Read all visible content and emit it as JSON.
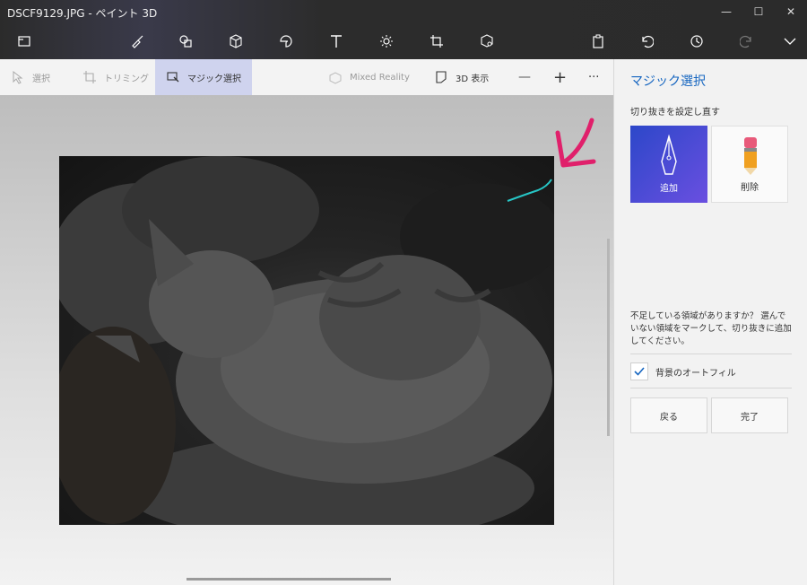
{
  "window": {
    "title": "DSCF9129.JPG - ペイント 3D",
    "buttons": [
      "—",
      "☐",
      "✕"
    ]
  },
  "toolbar": {
    "icons": [
      "menu-icon",
      "brush-icon",
      "2d-shapes-icon",
      "3d-shapes-icon",
      "stickers-icon",
      "text-icon",
      "effects-icon",
      "canvas-icon",
      "3d-library-icon",
      "paste-icon",
      "undo-icon",
      "history-icon",
      "redo-icon",
      "expand-icon"
    ]
  },
  "subbar": {
    "select": "選択",
    "crop": "トリミング",
    "magic_select": "マジック選択",
    "mixed_reality": "Mixed Reality",
    "view3d": "3D 表示",
    "zoom_out": "—",
    "zoom_in": "+",
    "more": "···"
  },
  "panel": {
    "title": "マジック選択",
    "subtitle": "切り抜きを設定し直す",
    "add_label": "追加",
    "delete_label": "削除",
    "help_text": "不足している領域がありますか？ 選んでいない領域をマークして、切り抜きに追加してください。",
    "autofill_label": "背景のオートフィル",
    "back_label": "戻る",
    "done_label": "完了"
  },
  "colors": {
    "accent_blue": "#1565c0",
    "active_tool_bg": "#cfd3ee",
    "add_gradient_start": "#2c47c9",
    "add_gradient_end": "#6a4fe0",
    "annotation_arrow": "#e0206b",
    "stroke_cyan": "#27c6c6"
  }
}
